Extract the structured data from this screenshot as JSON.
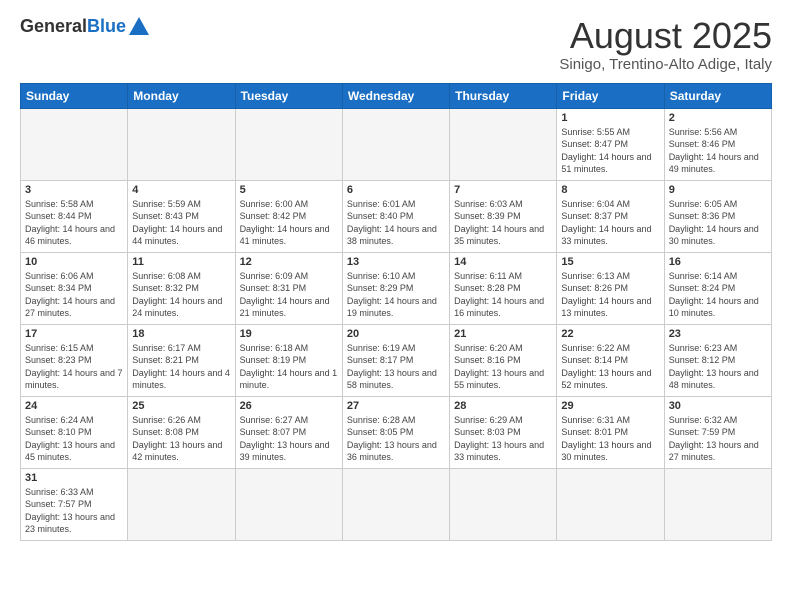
{
  "header": {
    "logo_general": "General",
    "logo_blue": "Blue",
    "month_title": "August 2025",
    "location": "Sinigo, Trentino-Alto Adige, Italy"
  },
  "weekdays": [
    "Sunday",
    "Monday",
    "Tuesday",
    "Wednesday",
    "Thursday",
    "Friday",
    "Saturday"
  ],
  "weeks": [
    [
      {
        "day": "",
        "info": ""
      },
      {
        "day": "",
        "info": ""
      },
      {
        "day": "",
        "info": ""
      },
      {
        "day": "",
        "info": ""
      },
      {
        "day": "",
        "info": ""
      },
      {
        "day": "1",
        "info": "Sunrise: 5:55 AM\nSunset: 8:47 PM\nDaylight: 14 hours and 51 minutes."
      },
      {
        "day": "2",
        "info": "Sunrise: 5:56 AM\nSunset: 8:46 PM\nDaylight: 14 hours and 49 minutes."
      }
    ],
    [
      {
        "day": "3",
        "info": "Sunrise: 5:58 AM\nSunset: 8:44 PM\nDaylight: 14 hours and 46 minutes."
      },
      {
        "day": "4",
        "info": "Sunrise: 5:59 AM\nSunset: 8:43 PM\nDaylight: 14 hours and 44 minutes."
      },
      {
        "day": "5",
        "info": "Sunrise: 6:00 AM\nSunset: 8:42 PM\nDaylight: 14 hours and 41 minutes."
      },
      {
        "day": "6",
        "info": "Sunrise: 6:01 AM\nSunset: 8:40 PM\nDaylight: 14 hours and 38 minutes."
      },
      {
        "day": "7",
        "info": "Sunrise: 6:03 AM\nSunset: 8:39 PM\nDaylight: 14 hours and 35 minutes."
      },
      {
        "day": "8",
        "info": "Sunrise: 6:04 AM\nSunset: 8:37 PM\nDaylight: 14 hours and 33 minutes."
      },
      {
        "day": "9",
        "info": "Sunrise: 6:05 AM\nSunset: 8:36 PM\nDaylight: 14 hours and 30 minutes."
      }
    ],
    [
      {
        "day": "10",
        "info": "Sunrise: 6:06 AM\nSunset: 8:34 PM\nDaylight: 14 hours and 27 minutes."
      },
      {
        "day": "11",
        "info": "Sunrise: 6:08 AM\nSunset: 8:32 PM\nDaylight: 14 hours and 24 minutes."
      },
      {
        "day": "12",
        "info": "Sunrise: 6:09 AM\nSunset: 8:31 PM\nDaylight: 14 hours and 21 minutes."
      },
      {
        "day": "13",
        "info": "Sunrise: 6:10 AM\nSunset: 8:29 PM\nDaylight: 14 hours and 19 minutes."
      },
      {
        "day": "14",
        "info": "Sunrise: 6:11 AM\nSunset: 8:28 PM\nDaylight: 14 hours and 16 minutes."
      },
      {
        "day": "15",
        "info": "Sunrise: 6:13 AM\nSunset: 8:26 PM\nDaylight: 14 hours and 13 minutes."
      },
      {
        "day": "16",
        "info": "Sunrise: 6:14 AM\nSunset: 8:24 PM\nDaylight: 14 hours and 10 minutes."
      }
    ],
    [
      {
        "day": "17",
        "info": "Sunrise: 6:15 AM\nSunset: 8:23 PM\nDaylight: 14 hours and 7 minutes."
      },
      {
        "day": "18",
        "info": "Sunrise: 6:17 AM\nSunset: 8:21 PM\nDaylight: 14 hours and 4 minutes."
      },
      {
        "day": "19",
        "info": "Sunrise: 6:18 AM\nSunset: 8:19 PM\nDaylight: 14 hours and 1 minute."
      },
      {
        "day": "20",
        "info": "Sunrise: 6:19 AM\nSunset: 8:17 PM\nDaylight: 13 hours and 58 minutes."
      },
      {
        "day": "21",
        "info": "Sunrise: 6:20 AM\nSunset: 8:16 PM\nDaylight: 13 hours and 55 minutes."
      },
      {
        "day": "22",
        "info": "Sunrise: 6:22 AM\nSunset: 8:14 PM\nDaylight: 13 hours and 52 minutes."
      },
      {
        "day": "23",
        "info": "Sunrise: 6:23 AM\nSunset: 8:12 PM\nDaylight: 13 hours and 48 minutes."
      }
    ],
    [
      {
        "day": "24",
        "info": "Sunrise: 6:24 AM\nSunset: 8:10 PM\nDaylight: 13 hours and 45 minutes."
      },
      {
        "day": "25",
        "info": "Sunrise: 6:26 AM\nSunset: 8:08 PM\nDaylight: 13 hours and 42 minutes."
      },
      {
        "day": "26",
        "info": "Sunrise: 6:27 AM\nSunset: 8:07 PM\nDaylight: 13 hours and 39 minutes."
      },
      {
        "day": "27",
        "info": "Sunrise: 6:28 AM\nSunset: 8:05 PM\nDaylight: 13 hours and 36 minutes."
      },
      {
        "day": "28",
        "info": "Sunrise: 6:29 AM\nSunset: 8:03 PM\nDaylight: 13 hours and 33 minutes."
      },
      {
        "day": "29",
        "info": "Sunrise: 6:31 AM\nSunset: 8:01 PM\nDaylight: 13 hours and 30 minutes."
      },
      {
        "day": "30",
        "info": "Sunrise: 6:32 AM\nSunset: 7:59 PM\nDaylight: 13 hours and 27 minutes."
      }
    ],
    [
      {
        "day": "31",
        "info": "Sunrise: 6:33 AM\nSunset: 7:57 PM\nDaylight: 13 hours and 23 minutes."
      },
      {
        "day": "",
        "info": ""
      },
      {
        "day": "",
        "info": ""
      },
      {
        "day": "",
        "info": ""
      },
      {
        "day": "",
        "info": ""
      },
      {
        "day": "",
        "info": ""
      },
      {
        "day": "",
        "info": ""
      }
    ]
  ]
}
